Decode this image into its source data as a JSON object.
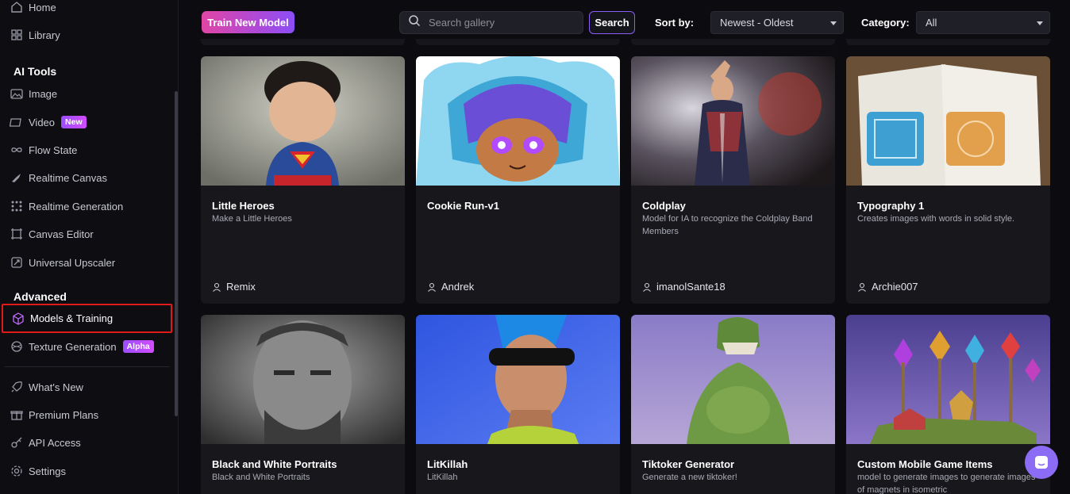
{
  "sidebar": {
    "home": "Home",
    "library": "Library",
    "ai_tools_heading": "AI Tools",
    "ai_tools": [
      {
        "label": "Image",
        "icon": "image-icon"
      },
      {
        "label": "Video",
        "icon": "video-icon",
        "badge": "New"
      },
      {
        "label": "Flow State",
        "icon": "infinity-icon"
      },
      {
        "label": "Realtime Canvas",
        "icon": "brush-icon"
      },
      {
        "label": "Realtime Generation",
        "icon": "dots-grid-icon"
      },
      {
        "label": "Canvas Editor",
        "icon": "frame-icon"
      },
      {
        "label": "Universal Upscaler",
        "icon": "upscale-icon"
      }
    ],
    "advanced_heading": "Advanced",
    "advanced": [
      {
        "label": "Models & Training",
        "icon": "cube-icon",
        "selected": true
      },
      {
        "label": "Texture Generation",
        "icon": "texture-icon",
        "badge": "Alpha"
      }
    ],
    "bottom": [
      {
        "label": "What's New",
        "icon": "rocket-icon"
      },
      {
        "label": "Premium Plans",
        "icon": "gift-icon"
      },
      {
        "label": "API Access",
        "icon": "key-icon"
      },
      {
        "label": "Settings",
        "icon": "gear-icon"
      }
    ]
  },
  "toolbar": {
    "train_label": "Train New Model",
    "search_placeholder": "Search gallery",
    "search_button": "Search",
    "sort_label": "Sort by:",
    "sort_value": "Newest - Oldest",
    "category_label": "Category:",
    "category_value": "All"
  },
  "cards": [
    {
      "title": "Little Heroes",
      "description": "Make a Little Heroes",
      "author": "Remix"
    },
    {
      "title": "Cookie Run-v1",
      "description": "",
      "author": "Andrek"
    },
    {
      "title": "Coldplay",
      "description": "Model for IA to recognize the Coldplay Band Members",
      "author": "imanolSante18"
    },
    {
      "title": "Typography 1",
      "description": "Creates images with words in solid style.",
      "author": "Archie007"
    },
    {
      "title": "Black and White Portraits",
      "description": "Black and White Portraits",
      "author": ""
    },
    {
      "title": "LitKillah",
      "description": "LitKillah",
      "author": ""
    },
    {
      "title": "Tiktoker Generator",
      "description": "Generate a new tiktoker!",
      "author": ""
    },
    {
      "title": "Custom Mobile Game Items",
      "description": "model to generate images to generate images of magnets in isometric",
      "author": ""
    }
  ],
  "colors": {
    "accent_purple": "#8b5cf6",
    "accent_pink": "#e045a6",
    "selection_outline": "#e01919",
    "background": "#0b0b10"
  }
}
